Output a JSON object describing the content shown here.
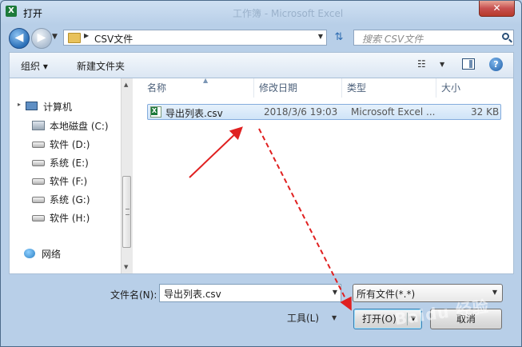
{
  "window": {
    "title": "打开",
    "ghost_title": "工作簿 - Microsoft Excel",
    "close_label": "✕"
  },
  "address_bar": {
    "path": "CSV文件",
    "search_placeholder": "搜索 CSV文件"
  },
  "toolbar": {
    "organize_label": "组织 ▾",
    "new_folder_label": "新建文件夹"
  },
  "nav_pane": {
    "items": [
      {
        "label": "计算机",
        "icon": "computer-icon"
      },
      {
        "label": "本地磁盘 (C:)",
        "icon": "system-drive-icon"
      },
      {
        "label": "软件 (D:)",
        "icon": "drive-icon"
      },
      {
        "label": "系统 (E:)",
        "icon": "drive-icon"
      },
      {
        "label": "软件 (F:)",
        "icon": "drive-icon"
      },
      {
        "label": "系统 (G:)",
        "icon": "drive-icon"
      },
      {
        "label": "软件 (H:)",
        "icon": "drive-icon"
      },
      {
        "label": "网络",
        "icon": "network-icon"
      }
    ]
  },
  "file_list": {
    "columns": [
      "名称",
      "修改日期",
      "类型",
      "大小"
    ],
    "rows": [
      {
        "name": "导出列表.csv",
        "modified": "2018/3/6 19:03",
        "type": "Microsoft Excel ...",
        "size": "32 KB"
      }
    ]
  },
  "footer": {
    "filename_label": "文件名(N):",
    "filename_value": "导出列表.csv",
    "filetype_value": "所有文件(*.*)",
    "tools_label": "工具(L)",
    "open_label": "打开(O)",
    "cancel_label": "取消"
  },
  "watermark": "Baidu 经验",
  "colors": {
    "selection": "#cfe4f8",
    "annotation_arrow": "#e02020"
  }
}
